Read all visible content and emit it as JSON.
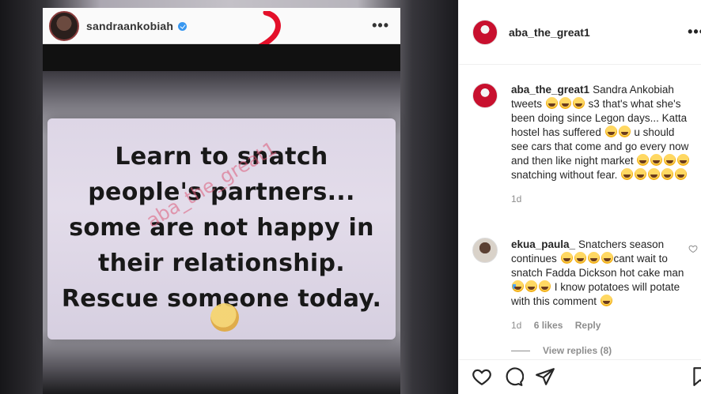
{
  "media": {
    "shot_username": "sandraankobiah",
    "card_lines": [
      "Learn to snatch",
      "people's partners...",
      "some are not happy in",
      "their relationship.",
      "Rescue someone today."
    ],
    "watermark": "aba_the_great1",
    "colors": {
      "annotation": "#e4102a",
      "watermark": "#dc5a78"
    }
  },
  "post": {
    "author": "aba_the_great1",
    "more_icon": "more-horizontal-icon"
  },
  "comments": [
    {
      "user": "aba_the_great1",
      "segments": [
        "Sandra Ankobiah tweets ",
        "joy",
        "joy",
        "joy",
        " s3 that's what she's been doing since Legon days... Katta hostel has suffered ",
        "joy",
        "joy",
        " u should see cars that come and go every now and then like night market ",
        "joy",
        "joy",
        "joy",
        "joy",
        "snatching without fear. ",
        "joy",
        "joy",
        "joy",
        "joy",
        "joy"
      ],
      "time": "1d"
    },
    {
      "user": "ekua_paula_",
      "segments": [
        "Snatchers season continues ",
        "joy",
        "joy",
        "joy",
        "joy",
        "cant wait to snatch Fadda Dickson hot cake man ",
        "smile",
        "joy",
        "joy",
        " I know potatoes will potate with this comment ",
        "rofl"
      ],
      "time": "1d",
      "likes": "6 likes",
      "reply": "Reply",
      "view_replies": "View replies (8)"
    }
  ],
  "actions": [
    "heart-icon",
    "comment-icon",
    "share-icon",
    "bookmark-icon"
  ]
}
